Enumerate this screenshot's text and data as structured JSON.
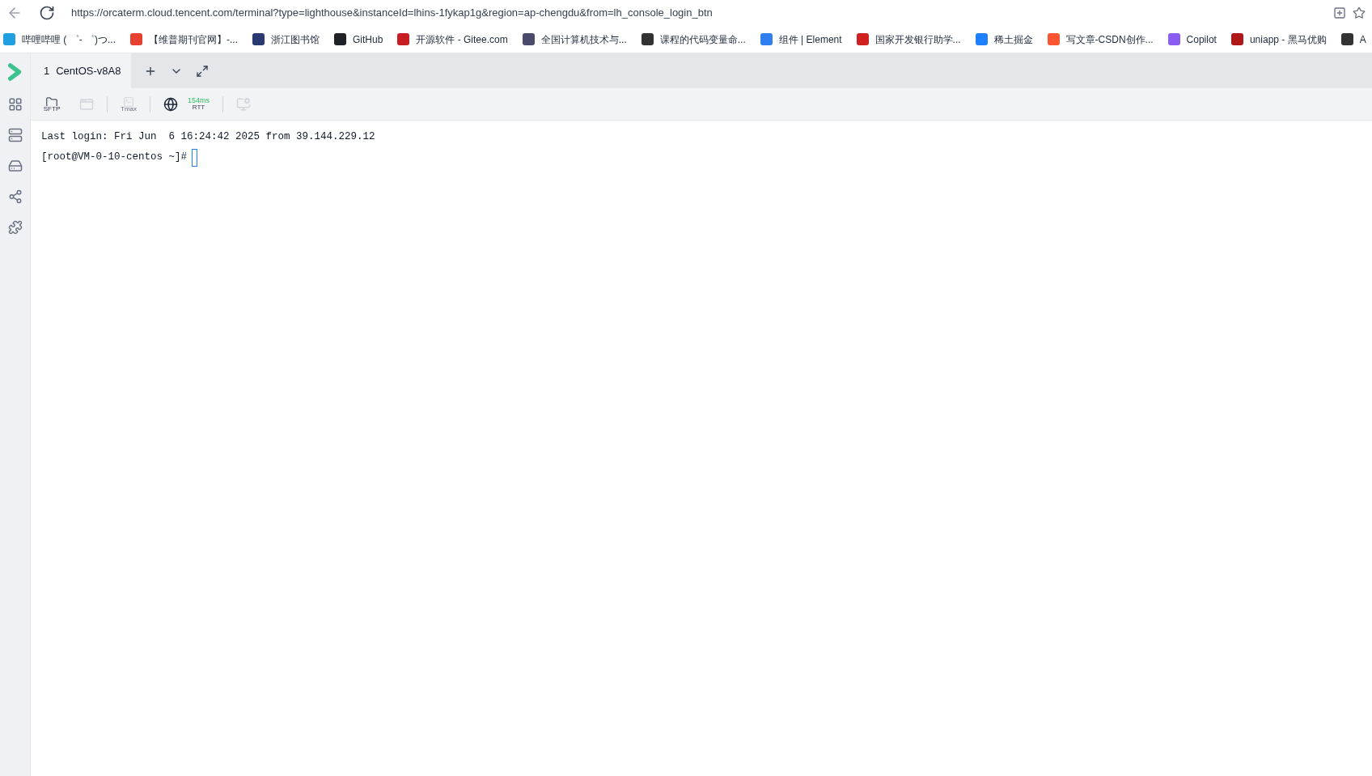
{
  "browser": {
    "url": "https://orcaterm.cloud.tencent.com/terminal?type=lighthouse&instanceId=lhins-1fykap1g&region=ap-chengdu&from=lh_console_login_btn"
  },
  "bookmarks": [
    {
      "label": "哔哩哔哩 ( ゜- ゜)つ...",
      "color": "#20a0e0"
    },
    {
      "label": "【维普期刊官网】-...",
      "color": "#e84030"
    },
    {
      "label": "浙江图书馆",
      "color": "#283a70"
    },
    {
      "label": "GitHub",
      "color": "#1f2328"
    },
    {
      "label": "开源软件 - Gitee.com",
      "color": "#c71d23"
    },
    {
      "label": "全国计算机技术与...",
      "color": "#4a4a6a"
    },
    {
      "label": "课程的代码变量命...",
      "color": "#333333"
    },
    {
      "label": "组件 | Element",
      "color": "#2f7ff0"
    },
    {
      "label": "国家开发银行助学...",
      "color": "#d02020"
    },
    {
      "label": "稀土掘金",
      "color": "#1e80ff"
    },
    {
      "label": "写文章-CSDN创作...",
      "color": "#fc5531"
    },
    {
      "label": "Copilot",
      "color": "#8a5cf0"
    },
    {
      "label": "uniapp - 黑马优购",
      "color": "#b01818"
    },
    {
      "label": "A",
      "color": "#333333"
    }
  ],
  "sidebar": {
    "items": [
      {
        "kind": "apps",
        "selected": false
      },
      {
        "kind": "servers",
        "selected": false
      },
      {
        "kind": "drive",
        "selected": false
      },
      {
        "kind": "share",
        "selected": false
      },
      {
        "kind": "plugin",
        "selected": false
      }
    ]
  },
  "tabs": [
    {
      "number": "1",
      "label": "CentOS-v8A8",
      "selected": true
    }
  ],
  "toolbar": {
    "sftp_label": "SFTP",
    "tmux_label": "Tmax",
    "latency": "154ms",
    "latency_label": "RTT"
  },
  "terminal": {
    "lines": [
      "Last login: Fri Jun  6 16:24:42 2025 from 39.144.229.12"
    ],
    "prompt": "[root@VM-0-10-centos ~]#"
  }
}
